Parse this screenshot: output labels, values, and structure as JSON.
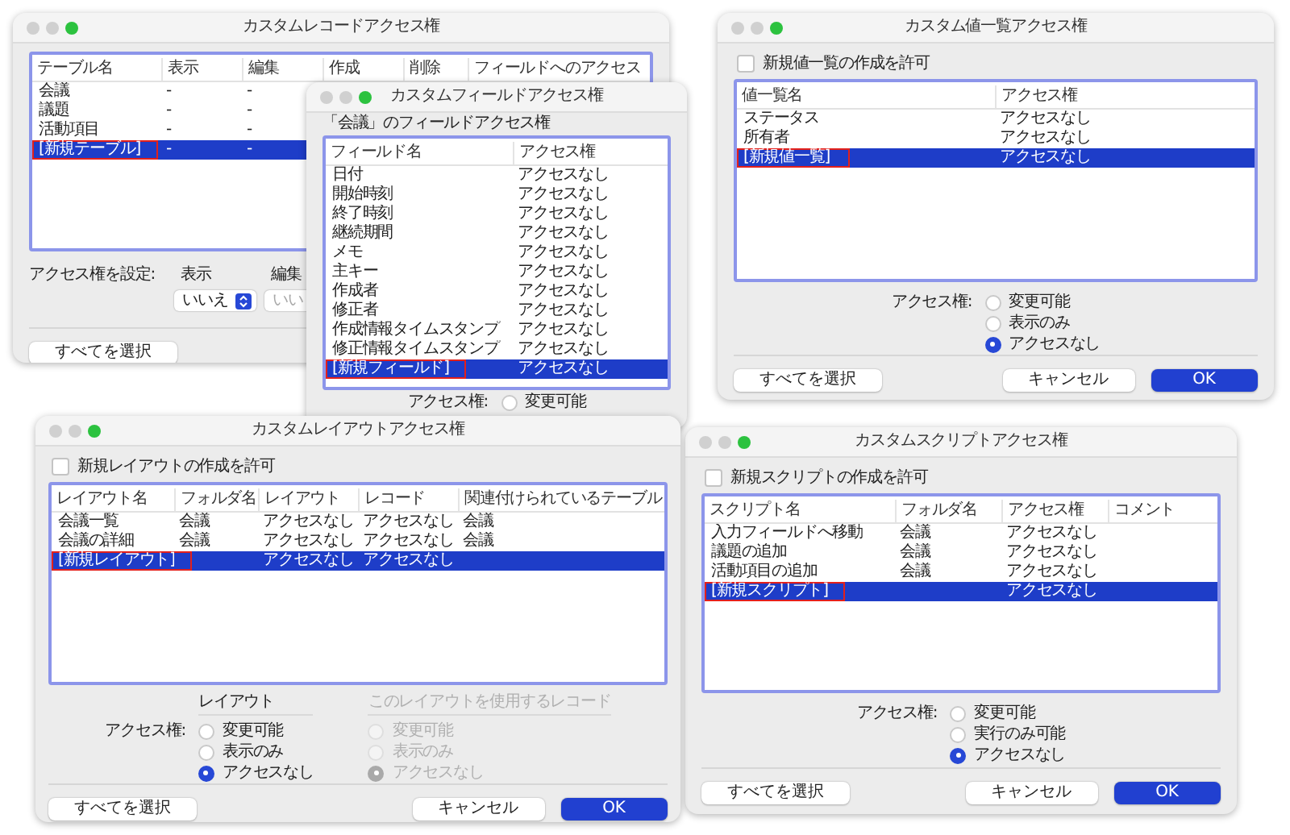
{
  "windows": [
    {
      "title": "カスタムレコードアクセス権",
      "table": {
        "columns": [
          "テーブル名",
          "表示",
          "編集",
          "作成",
          "削除",
          "フィールドへのアクセス"
        ],
        "rows": [
          {
            "cells": [
              "会議",
              "-",
              "-"
            ],
            "selected": false,
            "annotated": false
          },
          {
            "cells": [
              "議題",
              "-",
              "-"
            ],
            "selected": false,
            "annotated": false
          },
          {
            "cells": [
              "活動項目",
              "-",
              "-"
            ],
            "selected": false,
            "annotated": false
          },
          {
            "cells": [
              "[新規テーブル]",
              "-",
              "-"
            ],
            "selected": true,
            "annotated": true
          }
        ]
      },
      "set_access": {
        "label": "アクセス権を設定:",
        "fields": [
          {
            "label": "表示",
            "value": "いいえ",
            "disabled": false
          },
          {
            "label": "編集",
            "value": "いい",
            "disabled": true
          }
        ]
      },
      "buttons": [
        {
          "label": "すべてを選択",
          "kind": "default"
        }
      ]
    },
    {
      "title": "カスタムフィールドアクセス権",
      "subtitle": "「会議」のフィールドアクセス権",
      "table": {
        "columns": [
          "フィールド名",
          "アクセス権"
        ],
        "rows": [
          {
            "cells": [
              "日付",
              "アクセスなし"
            ],
            "selected": false,
            "annotated": false
          },
          {
            "cells": [
              "開始時刻",
              "アクセスなし"
            ],
            "selected": false,
            "annotated": false
          },
          {
            "cells": [
              "終了時刻",
              "アクセスなし"
            ],
            "selected": false,
            "annotated": false
          },
          {
            "cells": [
              "継続期間",
              "アクセスなし"
            ],
            "selected": false,
            "annotated": false
          },
          {
            "cells": [
              "メモ",
              "アクセスなし"
            ],
            "selected": false,
            "annotated": false
          },
          {
            "cells": [
              "主キー",
              "アクセスなし"
            ],
            "selected": false,
            "annotated": false
          },
          {
            "cells": [
              "作成者",
              "アクセスなし"
            ],
            "selected": false,
            "annotated": false
          },
          {
            "cells": [
              "修正者",
              "アクセスなし"
            ],
            "selected": false,
            "annotated": false
          },
          {
            "cells": [
              "作成情報タイムスタンプ",
              "アクセスなし"
            ],
            "selected": false,
            "annotated": false
          },
          {
            "cells": [
              "修正情報タイムスタンプ",
              "アクセスなし"
            ],
            "selected": false,
            "annotated": false
          },
          {
            "cells": [
              "[新規フィールド]",
              "アクセスなし"
            ],
            "selected": true,
            "annotated": true
          }
        ]
      },
      "access": {
        "label": "アクセス権:",
        "groups": [
          {
            "disabled": false,
            "options": [
              {
                "label": "変更可能",
                "selected": false
              }
            ]
          }
        ]
      }
    },
    {
      "title": "カスタム値一覧アクセス権",
      "allow": {
        "label": "新規値一覧の作成を許可",
        "checked": false
      },
      "table": {
        "columns": [
          "値一覧名",
          "アクセス権"
        ],
        "rows": [
          {
            "cells": [
              "ステータス",
              "アクセスなし"
            ],
            "selected": false,
            "annotated": false
          },
          {
            "cells": [
              "所有者",
              "アクセスなし"
            ],
            "selected": false,
            "annotated": false
          },
          {
            "cells": [
              "[新規値一覧]",
              "アクセスなし"
            ],
            "selected": true,
            "annotated": true
          }
        ]
      },
      "access": {
        "label": "アクセス権:",
        "groups": [
          {
            "disabled": false,
            "options": [
              {
                "label": "変更可能",
                "selected": false
              },
              {
                "label": "表示のみ",
                "selected": false
              },
              {
                "label": "アクセスなし",
                "selected": true
              }
            ]
          }
        ]
      },
      "buttons": [
        {
          "label": "すべてを選択",
          "kind": "default"
        },
        {
          "label": "キャンセル",
          "kind": "default"
        },
        {
          "label": "OK",
          "kind": "primary"
        }
      ]
    },
    {
      "title": "カスタムレイアウトアクセス権",
      "allow": {
        "label": "新規レイアウトの作成を許可",
        "checked": false
      },
      "table": {
        "columns": [
          "レイアウト名",
          "フォルダ名",
          "レイアウト",
          "レコード",
          "関連付けられているテーブル"
        ],
        "rows": [
          {
            "cells": [
              "会議一覧",
              "会議",
              "アクセスなし",
              "アクセスなし",
              "会議"
            ],
            "selected": false,
            "annotated": false
          },
          {
            "cells": [
              "会議の詳細",
              "会議",
              "アクセスなし",
              "アクセスなし",
              "会議"
            ],
            "selected": false,
            "annotated": false
          },
          {
            "cells": [
              "[新規レイアウト]",
              "",
              "アクセスなし",
              "アクセスなし"
            ],
            "selected": true,
            "annotated": true
          }
        ]
      },
      "access": {
        "label": "アクセス権:",
        "groups": [
          {
            "heading": "レイアウト",
            "disabled": false,
            "options": [
              {
                "label": "変更可能",
                "selected": false
              },
              {
                "label": "表示のみ",
                "selected": false
              },
              {
                "label": "アクセスなし",
                "selected": true
              }
            ]
          },
          {
            "heading": "このレイアウトを使用するレコード",
            "disabled": true,
            "options": [
              {
                "label": "変更可能",
                "selected": false
              },
              {
                "label": "表示のみ",
                "selected": false
              },
              {
                "label": "アクセスなし",
                "selected": true
              }
            ]
          }
        ]
      },
      "buttons": [
        {
          "label": "すべてを選択",
          "kind": "default"
        },
        {
          "label": "キャンセル",
          "kind": "default"
        },
        {
          "label": "OK",
          "kind": "primary"
        }
      ]
    },
    {
      "title": "カスタムスクリプトアクセス権",
      "allow": {
        "label": "新規スクリプトの作成を許可",
        "checked": false
      },
      "table": {
        "columns": [
          "スクリプト名",
          "フォルダ名",
          "アクセス権",
          "コメント"
        ],
        "rows": [
          {
            "cells": [
              "入力フィールドへ移動",
              "会議",
              "アクセスなし"
            ],
            "selected": false,
            "annotated": false
          },
          {
            "cells": [
              "議題の追加",
              "会議",
              "アクセスなし"
            ],
            "selected": false,
            "annotated": false
          },
          {
            "cells": [
              "活動項目の追加",
              "会議",
              "アクセスなし"
            ],
            "selected": false,
            "annotated": false
          },
          {
            "cells": [
              "[新規スクリプト]",
              "",
              "アクセスなし"
            ],
            "selected": true,
            "annotated": true
          }
        ]
      },
      "access": {
        "label": "アクセス権:",
        "groups": [
          {
            "disabled": false,
            "options": [
              {
                "label": "変更可能",
                "selected": false
              },
              {
                "label": "実行のみ可能",
                "selected": false
              },
              {
                "label": "アクセスなし",
                "selected": true
              }
            ]
          }
        ]
      },
      "buttons": [
        {
          "label": "すべてを選択",
          "kind": "default"
        },
        {
          "label": "キャンセル",
          "kind": "default"
        },
        {
          "label": "OK",
          "kind": "primary"
        }
      ]
    }
  ]
}
